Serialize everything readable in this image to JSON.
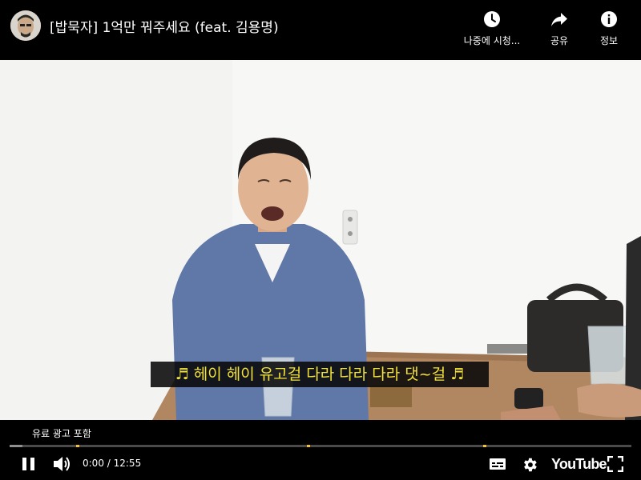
{
  "header": {
    "title": "[밥묵자] 1억만 꿔주세요 (feat. 김용명)",
    "channel_avatar": "channel-avatar",
    "watch_later_label": "나중에 시청...",
    "share_label": "공유",
    "info_label": "정보"
  },
  "video": {
    "subtitle": "♬ 헤이 헤이 유고걸 다라 다라 다라 댓~걸 ♬"
  },
  "player": {
    "ad_label": "유료 광고 포함",
    "current_time": "0:00",
    "duration": "12:55",
    "time_display": "0:00 / 12:55",
    "buffered_fraction": 0.02,
    "state": "playing",
    "logo": "YouTube",
    "controls": [
      "pause-icon",
      "volume-icon",
      "subtitles-icon",
      "settings-gear-icon",
      "fullscreen-icon"
    ]
  },
  "colors": {
    "subtitle_text": "#f3e23a",
    "ad_marker": "#f8c32a",
    "bar_background": "#000000"
  }
}
